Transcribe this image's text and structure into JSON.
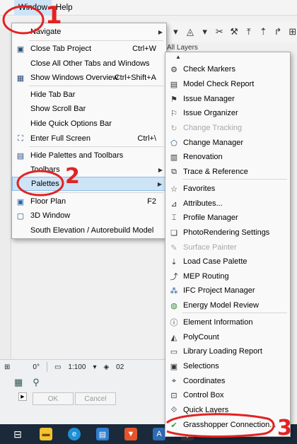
{
  "menubar": {
    "window": "Window",
    "help": "Help"
  },
  "background": {
    "layers_label": "All Layers",
    "status": {
      "angle": "0°",
      "scale": "1:100",
      "layer_num": "02"
    },
    "buttons": {
      "ok": "OK",
      "cancel": "Cancel"
    }
  },
  "window_menu": {
    "navigate": "Navigate",
    "close_tab_project": "Close Tab Project",
    "close_tab_project_sc": "Ctrl+W",
    "close_all_tabs": "Close All Other Tabs and Windows",
    "show_windows_overview": "Show Windows Overview",
    "show_windows_overview_sc": "Ctrl+Shift+A",
    "hide_tab_bar": "Hide Tab Bar",
    "show_scroll_bar": "Show Scroll Bar",
    "hide_quick_options": "Hide Quick Options Bar",
    "enter_full_screen": "Enter Full Screen",
    "enter_full_screen_sc": "Ctrl+\\",
    "hide_palettes": "Hide Palettes and Toolbars",
    "toolbars": "Toolbars",
    "palettes": "Palettes",
    "floor_plan": "Floor Plan",
    "floor_plan_sc": "F2",
    "window_3d": "3D Window",
    "south_elevation": "South Elevation / Autorebuild Model"
  },
  "palettes_menu": {
    "items": [
      {
        "label": "Check Markers",
        "icon": "check-markers-icon",
        "enabled": true
      },
      {
        "label": "Model Check Report",
        "icon": "report-icon",
        "enabled": true
      },
      {
        "label": "Issue Manager",
        "icon": "issue-icon",
        "enabled": true
      },
      {
        "label": "Issue Organizer",
        "icon": "flag-icon",
        "enabled": true
      },
      {
        "label": "Change Tracking",
        "icon": "tracking-icon",
        "enabled": false
      },
      {
        "label": "Change Manager",
        "icon": "change-icon",
        "enabled": true
      },
      {
        "label": "Renovation",
        "icon": "renovation-icon",
        "enabled": true
      },
      {
        "label": "Trace & Reference",
        "icon": "trace-icon",
        "enabled": true
      },
      {
        "label": "Favorites",
        "icon": "star-icon",
        "enabled": true
      },
      {
        "label": "Attributes...",
        "icon": "attributes-icon",
        "enabled": true
      },
      {
        "label": "Profile Manager",
        "icon": "profile-icon",
        "enabled": true
      },
      {
        "label": "PhotoRendering Settings",
        "icon": "render-icon",
        "enabled": true
      },
      {
        "label": "Surface Painter",
        "icon": "painter-icon",
        "enabled": false
      },
      {
        "label": "Load Case Palette",
        "icon": "load-case-icon",
        "enabled": true
      },
      {
        "label": "MEP Routing",
        "icon": "mep-icon",
        "enabled": true
      },
      {
        "label": "IFC Project Manager",
        "icon": "ifc-icon",
        "enabled": true
      },
      {
        "label": "Energy Model Review",
        "icon": "globe-icon",
        "enabled": true
      },
      {
        "label": "Element Information",
        "icon": "info-icon",
        "enabled": true
      },
      {
        "label": "PolyCount",
        "icon": "polycount-icon",
        "enabled": true
      },
      {
        "label": "Library Loading Report",
        "icon": "library-icon",
        "enabled": true
      },
      {
        "label": "Selections",
        "icon": "selections-icon",
        "enabled": true
      },
      {
        "label": "Coordinates",
        "icon": "coordinates-icon",
        "enabled": true
      },
      {
        "label": "Control Box",
        "icon": "control-box-icon",
        "enabled": true
      },
      {
        "label": "Quick Layers",
        "icon": "layers-icon",
        "enabled": true
      },
      {
        "label": "Grasshopper Connection...",
        "icon": "grasshopper-icon",
        "enabled": true
      }
    ]
  },
  "annotations": {
    "one": "1",
    "two": "2",
    "three": "3"
  },
  "colors": {
    "annotation": "#e32222",
    "highlight": "#cde4f7",
    "taskbar": "#1b2a3a"
  }
}
